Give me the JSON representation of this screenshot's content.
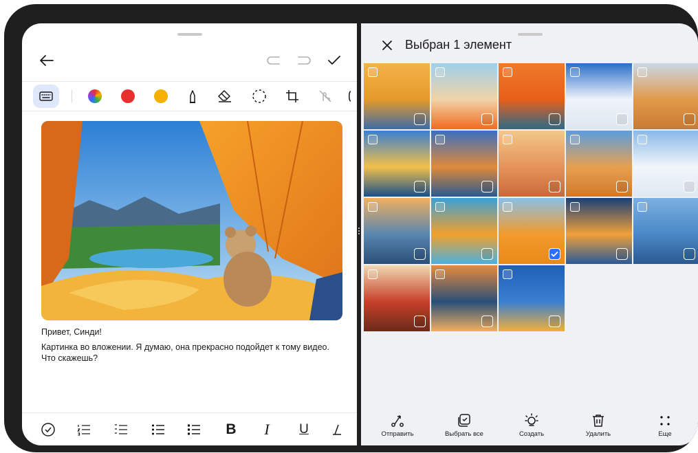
{
  "left": {
    "toolbar_colors": [
      "#e8302f",
      "#f5b000"
    ],
    "greeting": "Привет, Синди!",
    "message": "Картинка во вложении. Я думаю, она прекрасно подойдет к тому видео. Что скажешь?",
    "bold_label": "B",
    "italic_label": "I",
    "underline_label": "U"
  },
  "right": {
    "title": "Выбран 1 элемент",
    "accent": "#2f6fff",
    "photos": [
      {
        "name": "photo-woman-field",
        "colors": [
          "#f4b24a",
          "#e49a2a",
          "#3f6aa8"
        ],
        "checked": false
      },
      {
        "name": "photo-paper-boat",
        "colors": [
          "#9fd0ea",
          "#f0d3a8",
          "#f26a1f"
        ],
        "checked": false
      },
      {
        "name": "photo-beach-items",
        "colors": [
          "#f07a2a",
          "#e85f1a",
          "#2a6a8a"
        ],
        "checked": false
      },
      {
        "name": "photo-skier",
        "colors": [
          "#2a6fc8",
          "#f0f4fb",
          "#dde6ef"
        ],
        "checked": false
      },
      {
        "name": "photo-camels-desert",
        "colors": [
          "#c9d8e6",
          "#e19a4a",
          "#c97a32"
        ],
        "checked": false
      },
      {
        "name": "photo-colorful-houses",
        "colors": [
          "#3a7fd0",
          "#f2c04a",
          "#1a4f8a"
        ],
        "checked": false
      },
      {
        "name": "photo-rock-arch",
        "colors": [
          "#3a6fc0",
          "#e08a3a",
          "#2a5a90"
        ],
        "checked": false
      },
      {
        "name": "photo-beach-chairs",
        "colors": [
          "#f2c88a",
          "#e6935a",
          "#c76a3a"
        ],
        "checked": false
      },
      {
        "name": "photo-desert-rock",
        "colors": [
          "#5a9ee0",
          "#e8a050",
          "#d0782a"
        ],
        "checked": false
      },
      {
        "name": "photo-snow-chairs",
        "colors": [
          "#8ab8e8",
          "#f2f6fb",
          "#dfe8f2"
        ],
        "checked": false
      },
      {
        "name": "photo-coast-road",
        "colors": [
          "#f0b060",
          "#5a86b0",
          "#2a4f78"
        ],
        "checked": false
      },
      {
        "name": "photo-umbrella-sea",
        "colors": [
          "#3aa0d8",
          "#f2a02a",
          "#4ab0e0"
        ],
        "checked": false
      },
      {
        "name": "photo-tent-view",
        "colors": [
          "#8ac0e8",
          "#f39a2a",
          "#e88a1a"
        ],
        "checked": true
      },
      {
        "name": "photo-night-lamp",
        "colors": [
          "#1a3f78",
          "#f0a03a",
          "#2a5a98"
        ],
        "checked": false
      },
      {
        "name": "photo-highway",
        "colors": [
          "#7ab0e0",
          "#4a88c8",
          "#2a5a90"
        ],
        "checked": false
      },
      {
        "name": "photo-temple",
        "colors": [
          "#f0d8b0",
          "#c8402a",
          "#6a2a1a"
        ],
        "checked": false
      },
      {
        "name": "photo-bridge",
        "colors": [
          "#e88a3a",
          "#2a4f78",
          "#f2b060"
        ],
        "checked": false
      },
      {
        "name": "photo-balloon",
        "colors": [
          "#1f5fb8",
          "#3a7fd0",
          "#f0b03a"
        ],
        "checked": false
      }
    ],
    "actions": [
      {
        "name": "send",
        "label": "Отправить",
        "icon": "share-icon"
      },
      {
        "name": "select-all",
        "label": "Выбрать все",
        "icon": "select-all-icon"
      },
      {
        "name": "create",
        "label": "Создать",
        "icon": "bulb-icon"
      },
      {
        "name": "delete",
        "label": "Удалить",
        "icon": "trash-icon"
      },
      {
        "name": "more",
        "label": "Еще",
        "icon": "more-icon"
      }
    ]
  }
}
